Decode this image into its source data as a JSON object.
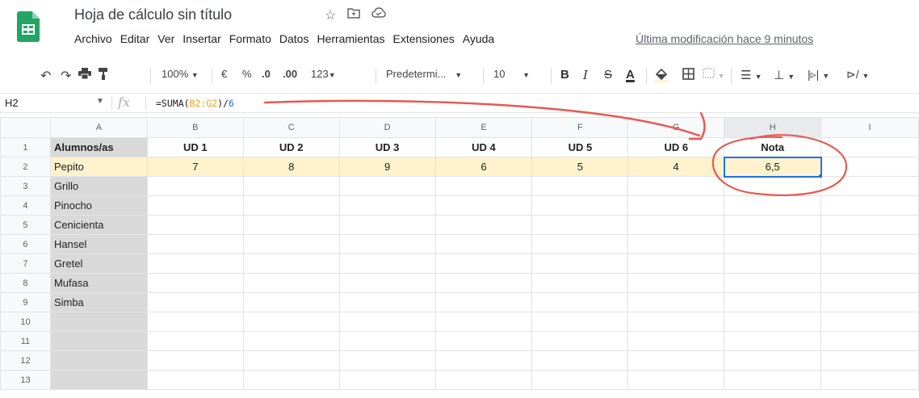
{
  "document": {
    "title": "Hoja de cálculo sin título",
    "last_edit": "Última modificación hace 9 minutos"
  },
  "menu": [
    "Archivo",
    "Editar",
    "Ver",
    "Insertar",
    "Formato",
    "Datos",
    "Herramientas",
    "Extensiones",
    "Ayuda"
  ],
  "toolbar": {
    "zoom": "100%",
    "currency": "€",
    "percent": "%",
    "decrease_decimals": ".0",
    "increase_decimals": ".00",
    "more_formats": "123",
    "font": "Predetermi...",
    "font_size": "10",
    "bold": "B",
    "italic": "I",
    "strikethrough": "S",
    "text_color": "A"
  },
  "formula_bar": {
    "cell_ref": "H2",
    "fx": "fx",
    "fn": "=SUMA(",
    "range": "B2:G2",
    "close": ")/",
    "divisor": "6"
  },
  "sheet": {
    "columns": [
      "A",
      "B",
      "C",
      "D",
      "E",
      "F",
      "G",
      "H",
      "I"
    ],
    "rows": [
      "1",
      "2",
      "3",
      "4",
      "5",
      "6",
      "7",
      "8",
      "9",
      "10",
      "11",
      "12",
      "13"
    ],
    "header_row": [
      "Alumnos/as",
      "UD 1",
      "UD 2",
      "UD 3",
      "UD 4",
      "UD 5",
      "UD 6",
      "Nota"
    ],
    "data_row": [
      "Pepito",
      "7",
      "8",
      "9",
      "6",
      "5",
      "4",
      "6,5"
    ],
    "students": [
      "Grillo",
      "Pinocho",
      "Cenicienta",
      "Hansel",
      "Gretel",
      "Mufasa",
      "Simba"
    ],
    "active_cell": "H2"
  },
  "colors": {
    "accent": "#1a73e8",
    "highlight_row": "#fff2cc",
    "name_column": "#d9d9d9",
    "annotation": "#e8594f",
    "range_color": "#f4a300"
  }
}
